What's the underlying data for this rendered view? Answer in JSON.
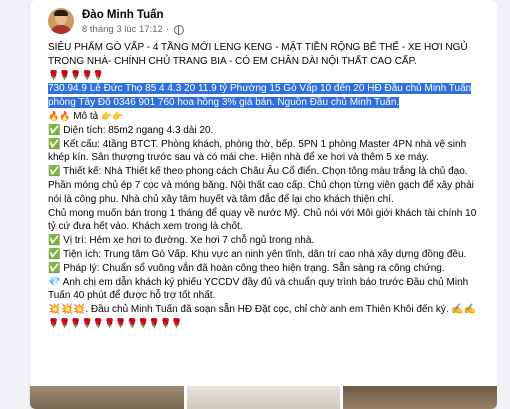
{
  "post": {
    "author": "Đào Minh Tuấn",
    "time": "8 tháng 3 lúc 17:12",
    "line1": "SIÊU PHẨM GÒ VẤP - 4 TẦNG MỚI LENG KENG - MẶT TIỀN RỘNG BỂ THẾ -  XE HƠI NGỦ TRONG NHÀ- CHÍNH CHỦ TRANG BIA - CÓ EM CHÂN DÀI NỘI THẤT CAO CẤP.",
    "roses1": "🌹🌹🌹🌹🌹",
    "highlight": "730.94.9 Lê Đức Thọ 85 4 4.3 20 11.9 tỷ Phường 15 Gò Vấp 10 đến 20 HĐ Đầu chủ Minh Tuấn phòng Tây Đô 0346 901 760 hoa hồng 3% giá bán. Nguồn Đầu chủ Minh Tuấn.",
    "mota_prefix": "🔥🔥",
    "mota": "Mô tả",
    "mota_suffix": "👉👉",
    "dientich": "✅ Diện tích: 85m2 ngang 4.3 dài 20.",
    "ketcau": "✅ Kết cấu: 4tầng BTCT. Phòng khách, phòng thờ, bếp. 5PN 1 phòng Master 4PN nhà vệ sinh khép kín. Sân thượng trước sau và có mái che. Hiện nhà để xe hơi và thêm 5 xe máy.",
    "thietke": "✅ Thiết kế: Nhà Thiết kế theo phong cách Châu Âu Cổ điển. Chọn tông màu trắng là chủ đạo. Phần móng chủ ép 7 cọc và móng băng. Nội thất cao cấp. Chủ chọn từng viên gạch để xây phải nói là công phu. Nhà chủ xây tâm huyết và tâm đắc để lại cho khách thiện chí.",
    "chumuong": "Chủ mong muốn bán trong 1 tháng để quay về nước Mỹ. Chủ nói với Môi giới khách tài chính 10 tỷ cứ đưa hết vào. Khách xem trong là chốt.",
    "vitri": "✅ Vị trí: Hẻm xe hơi to đường. Xe hơi 7 chỗ ngủ trong nhà.",
    "tienich": "✅ Tiện ích: Trung tâm Gò Vấp. Khu vực an ninh yên tĩnh, dân trí cao nhà xây dựng đồng đều.",
    "phaply": "✅ Pháp lý: Chuẩn sổ vuông vắn đã hoàn công theo hiện trạng. Sẵn sàng ra công chứng.",
    "anhchi": "💎 Anh chị em dẫn khách ký phiếu YCCDV đầy đủ và chuẩn quy trình báo trước Đầu chủ Minh Tuấn 40 phút để được hỗ trợ tốt nhất.",
    "dauchu": "💥💥💥. Đầu chủ Minh Tuấn đã soạn sẵn HĐ Đặt cọc, chỉ chờ anh em Thiên Khôi đến ký. ✍✍",
    "roses2": "🌹🌹🌹🌹🌹🌹🌹🌹🌹🌹🌹🌹"
  }
}
